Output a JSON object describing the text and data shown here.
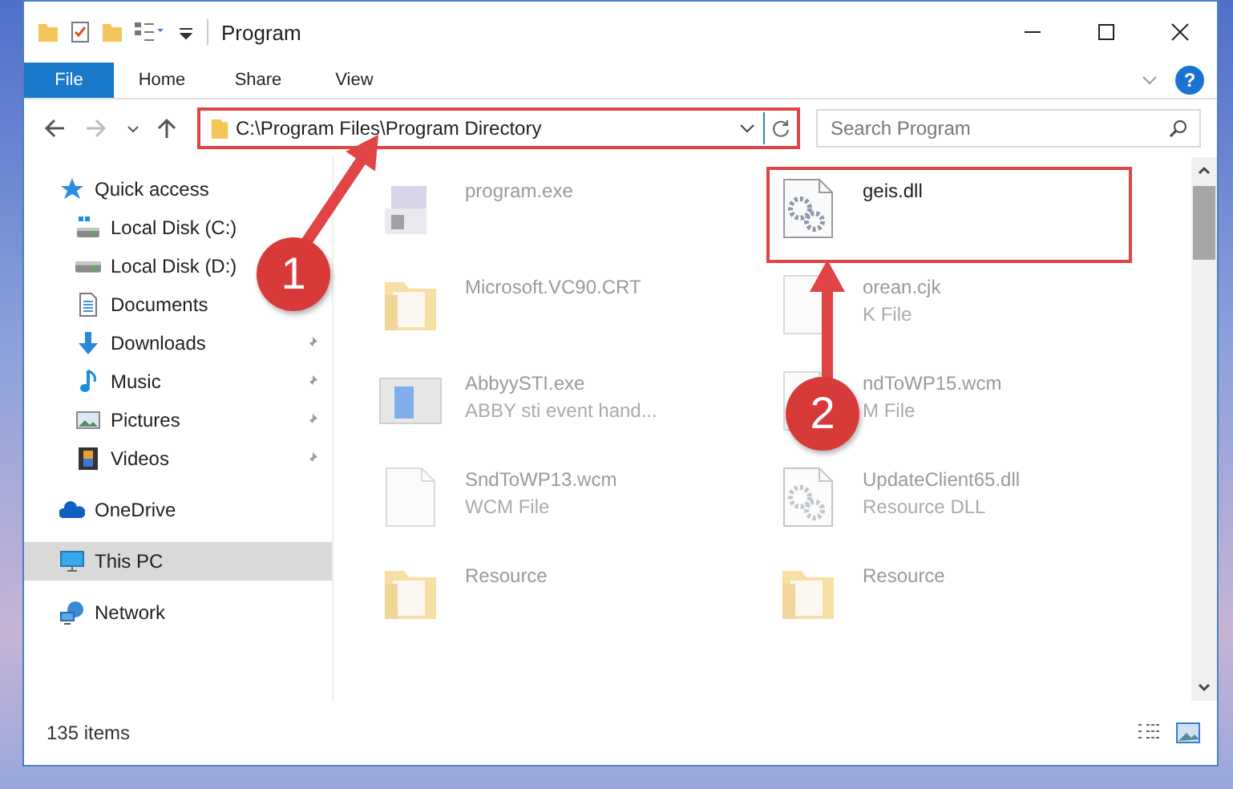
{
  "window": {
    "title": "Program"
  },
  "ribbon_tabs": [
    {
      "label": "File",
      "selected": true
    },
    {
      "label": "Home",
      "selected": false
    },
    {
      "label": "Share",
      "selected": false
    },
    {
      "label": "View",
      "selected": false
    }
  ],
  "help": "?",
  "address": {
    "path": "C:\\Program Files\\Program Directory",
    "highlighted": true
  },
  "search": {
    "placeholder": "Search Program"
  },
  "sidebar": {
    "items": [
      {
        "label": "Quick access",
        "kind": "star",
        "selected": false,
        "pinned": false,
        "children": [
          {
            "label": "Local Disk (C:)",
            "kind": "drive-win",
            "selected": false,
            "pinned": false
          },
          {
            "label": "Local Disk (D:)",
            "kind": "drive",
            "selected": false,
            "pinned": false
          },
          {
            "label": "Documents",
            "kind": "documents",
            "selected": false,
            "pinned": false
          },
          {
            "label": "Downloads",
            "kind": "downloads",
            "selected": false,
            "pinned": true
          },
          {
            "label": "Music",
            "kind": "music",
            "selected": false,
            "pinned": true
          },
          {
            "label": "Pictures",
            "kind": "pictures",
            "selected": false,
            "pinned": true
          },
          {
            "label": "Videos",
            "kind": "videos",
            "selected": false,
            "pinned": true
          }
        ]
      },
      {
        "label": "OneDrive",
        "kind": "cloud",
        "selected": false,
        "pinned": false
      },
      {
        "label": "This PC",
        "kind": "pc",
        "selected": true,
        "pinned": false
      },
      {
        "label": "Network",
        "kind": "network",
        "selected": false,
        "pinned": false
      }
    ]
  },
  "files": [
    {
      "name": "program.exe",
      "kind": "installer",
      "highlighted": false,
      "dimmed": true
    },
    {
      "name": "geis.dll",
      "kind": "gear-file",
      "highlighted": true,
      "dimmed": false
    },
    {
      "name": "Microsoft.VC90.CRT",
      "kind": "folder",
      "highlighted": false,
      "dimmed": true
    },
    {
      "name": "orean.cjk",
      "subtitle": "K File",
      "kind": "file",
      "highlighted": false,
      "dimmed": true
    },
    {
      "name": "AbbyySTI.exe",
      "subtitle": "ABBY sti event hand...",
      "kind": "app",
      "highlighted": false,
      "dimmed": true
    },
    {
      "name": "ndToWP15.wcm",
      "subtitle": "M File",
      "kind": "file",
      "highlighted": false,
      "dimmed": true
    },
    {
      "name": "SndToWP13.wcm",
      "subtitle": "WCM File",
      "kind": "file",
      "highlighted": false,
      "dimmed": true
    },
    {
      "name": "UpdateClient65.dll",
      "subtitle": "Resource DLL",
      "kind": "gear-file",
      "highlighted": false,
      "dimmed": true
    },
    {
      "name": "Resource",
      "kind": "folder",
      "highlighted": false,
      "dimmed": true
    },
    {
      "name": "Resource",
      "kind": "folder",
      "highlighted": false,
      "dimmed": true
    }
  ],
  "status_bar": {
    "item_count": "135 items"
  },
  "annotations": [
    {
      "number": "1"
    },
    {
      "number": "2"
    }
  ]
}
